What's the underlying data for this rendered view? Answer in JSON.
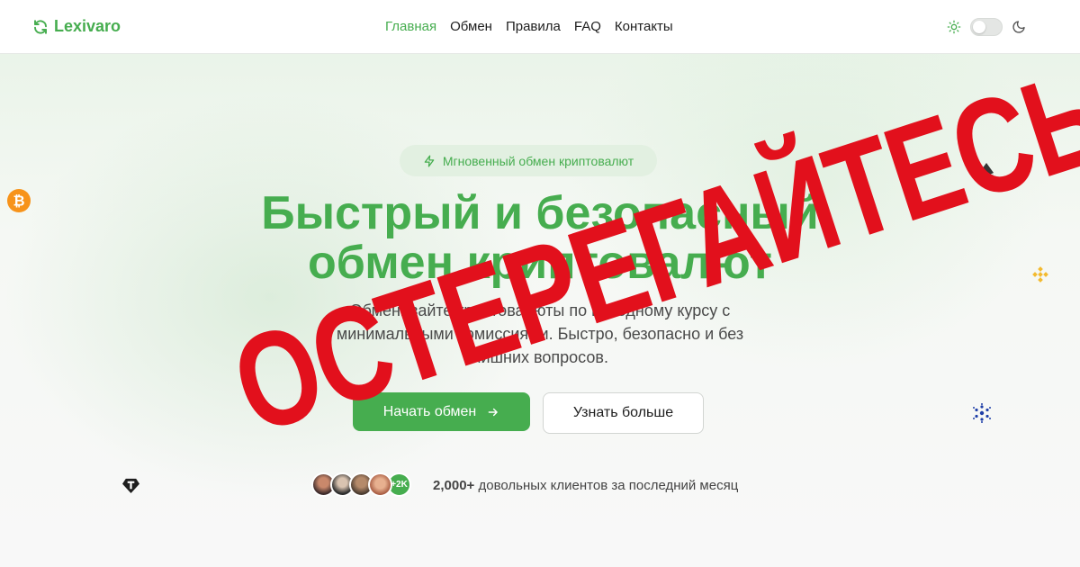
{
  "header": {
    "logo_text": "Lexivaro",
    "nav": [
      {
        "label": "Главная",
        "active": true
      },
      {
        "label": "Обмен"
      },
      {
        "label": "Правила"
      },
      {
        "label": "FAQ"
      },
      {
        "label": "Контакты"
      }
    ],
    "theme_icons": [
      "sun-icon",
      "moon-icon"
    ]
  },
  "hero": {
    "badge": "Мгновенный обмен криптовалют",
    "title_line1": "Быстрый и безопасный",
    "title_line2": "обмен криптовалют",
    "subtitle_line1": "Обменивайте криптовалюты по выгодному курсу с",
    "subtitle_line2": "минимальными комиссиями. Быстро, безопасно и без",
    "subtitle_line3": "лишних вопросов.",
    "primary_button": "Начать обмен",
    "secondary_button": "Узнать больше"
  },
  "social_proof": {
    "more_badge": "+2K",
    "count": "2,000+",
    "text": "довольных клиентов за последний месяц"
  },
  "overlay": {
    "warning": "ОСТЕРЕГАЙТЕСЬ!"
  },
  "colors": {
    "brand": "#46ad4f",
    "warning": "#e2101c"
  },
  "coins": [
    "bitcoin-icon",
    "ethereum-icon",
    "binance-icon",
    "cardano-icon",
    "tether-icon"
  ]
}
